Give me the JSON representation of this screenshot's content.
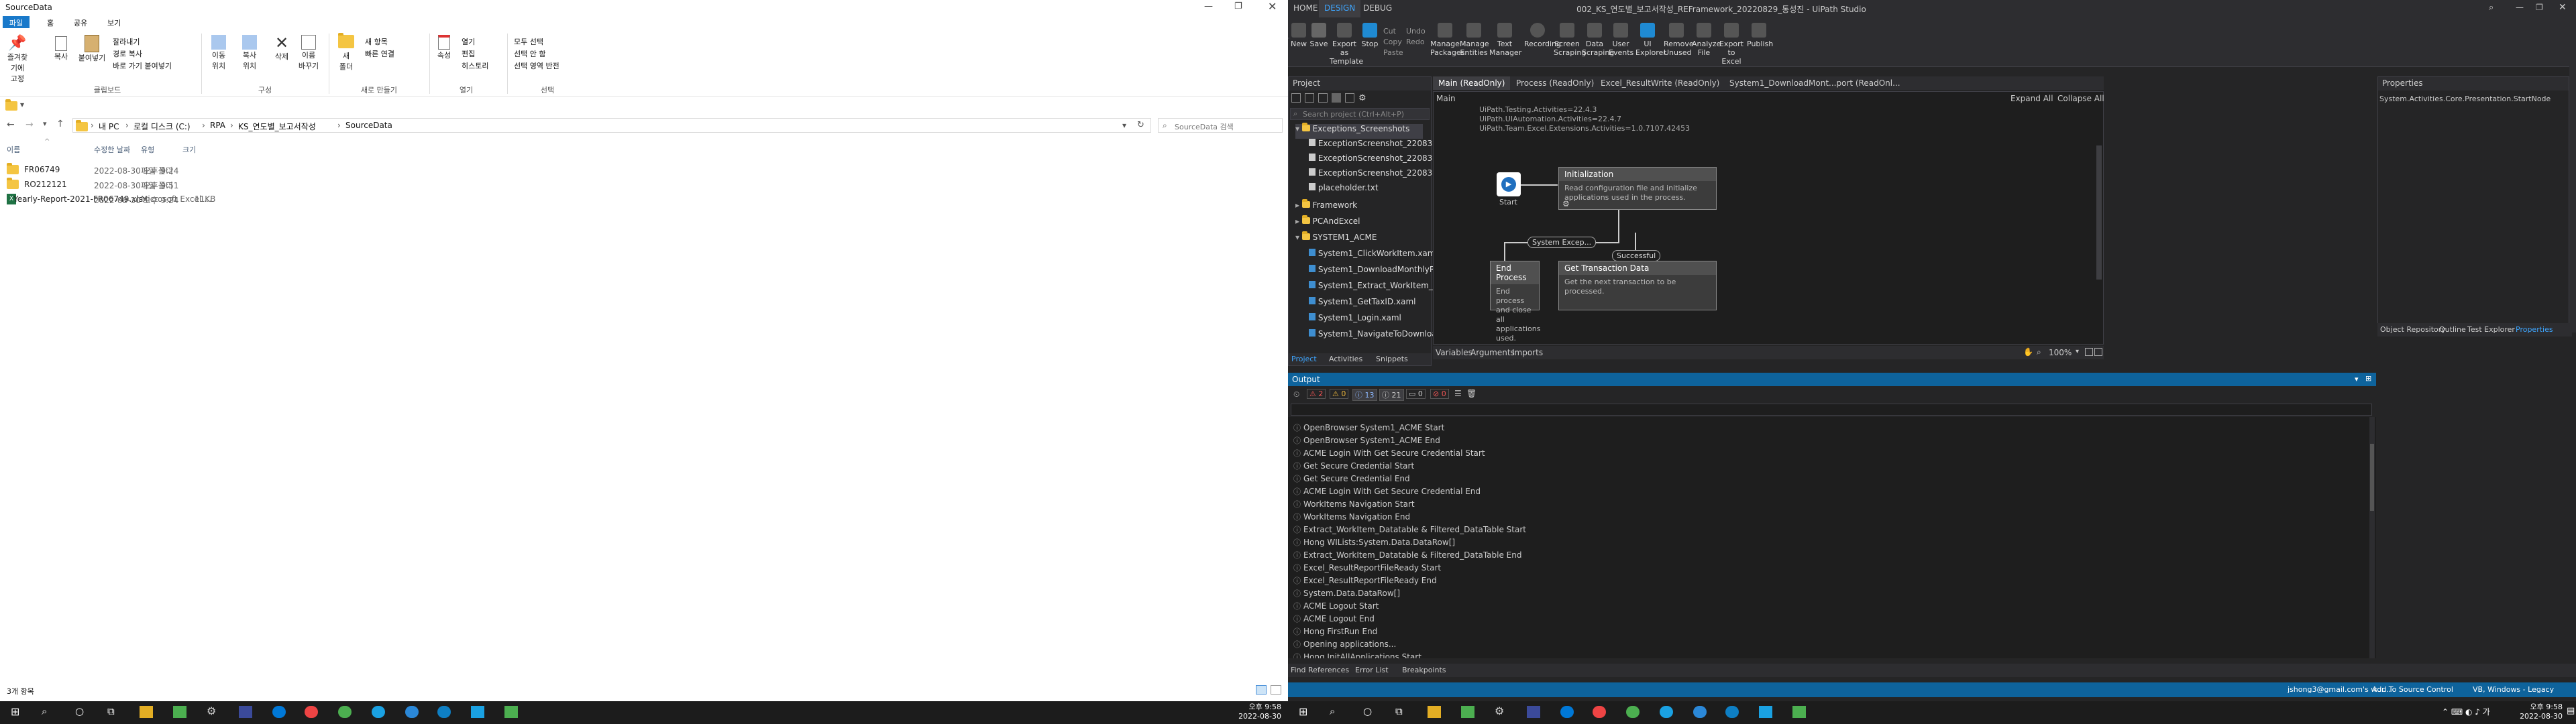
{
  "explorer": {
    "title": "SourceData",
    "tabs": [
      "파일",
      "홈",
      "공유",
      "보기"
    ],
    "ribbon": {
      "buttons": [
        "즐겨찾기에\n고정",
        "복사",
        "붙여넣기",
        "이동\n위치",
        "복사\n위치",
        "삭제",
        "이름\n바꾸기",
        "새\n폴더",
        "속성",
        "모두 선택",
        "선택 안 함",
        "선택 영역 반전",
        "열기",
        "편집",
        "히스토리"
      ],
      "small": [
        "잘라내기",
        "경로 복사",
        "바로 가기 붙여넣기",
        "새 항목",
        "빠른 연결"
      ],
      "groups": [
        "클립보드",
        "구성",
        "새로 만들기",
        "열기",
        "선택"
      ]
    },
    "breadcrumb": [
      "내 PC",
      "로컬 디스크 (C:)",
      "RPA",
      "KS_연도별_보고서작성",
      "SourceData"
    ],
    "search_placeholder": "SourceData 검색",
    "columns": [
      "이름",
      "수정한 날짜",
      "유형",
      "크기"
    ],
    "files": [
      {
        "name": "FR06749",
        "date": "2022-08-30 오후 9:24",
        "type": "파일 폴더",
        "size": ""
      },
      {
        "name": "RO212121",
        "date": "2022-08-30 오후 9:51",
        "type": "파일 폴더",
        "size": ""
      },
      {
        "name": "Yearly-Report-2021-FR06749.xlsx",
        "date": "2022-08-30 오후 9:24",
        "type": "Microsoft Excel ...",
        "size": "11KB"
      }
    ],
    "status": "3개 항목"
  },
  "studio": {
    "title": "002_KS_연도별_보고서작성_REFramework_20220829_통성진 - UiPath Studio",
    "menu": [
      "HOME",
      "DESIGN",
      "DEBUG"
    ],
    "toolbar": [
      "New",
      "Save",
      "Export as Template",
      "Stop",
      "Manage Packages",
      "Manage Entities",
      "Text Manager",
      "Recording",
      "Screen Scraping",
      "Data Scraping",
      "User Events",
      "UI Explorer",
      "Remove Unused",
      "Analyze File",
      "Export to Excel",
      "Publish"
    ],
    "small": [
      "Cut",
      "Copy",
      "Paste",
      "Undo",
      "Redo"
    ],
    "project": {
      "title": "Project",
      "search_placeholder": "Search project (Ctrl+Alt+P)",
      "items": [
        "Exceptions_Screenshots",
        "ExceptionScreenshot_220830.092507.png",
        "ExceptionScreenshot_220830.093045.png",
        "ExceptionScreenshot_220830.095226.png",
        "placeholder.txt",
        "Framework",
        "PCAndExcel",
        "SYSTEM1_ACME",
        "System1_ClickWorkItem.xaml",
        "System1_DownloadMonthlyReport.xaml",
        "System1_Extract_WorkItem_DataTable.xaml",
        "System1_GetTaxID.xaml",
        "System1_Login.xaml",
        "System1_NavigateToDownload.xaml"
      ],
      "tabs": [
        "Project",
        "Activities",
        "Snippets"
      ]
    },
    "doc_tabs": [
      "Main (ReadOnly)",
      "Process (ReadOnly)",
      "Excel_ResultWrite (ReadOnly)",
      "System1_DownloadMont...port (ReadOnl..."
    ],
    "designer": {
      "breadcrumb": "Main",
      "expand": "Expand All",
      "collapse": "Collapse All",
      "imports": [
        "UiPath.Testing.Activities=22.4.3",
        "UiPath.UIAutomation.Activities=22.4.7",
        "UiPath.Team.Excel.Extensions.Activities=1.0.7107.42453"
      ],
      "start": "Start",
      "init_title": "Initialization",
      "init_desc": "Read configuration file and initialize applications used in the process.",
      "system_label": "System Excep...",
      "success_label": "Successful",
      "end_title": "End Process",
      "end_desc": "End process and close all applications used.",
      "get_title": "Get Transaction Data",
      "get_desc": "Get the next transaction to be processed.",
      "bottom_tabs": [
        "Variables",
        "Arguments",
        "Imports"
      ],
      "zoom": "100%"
    },
    "properties": {
      "title": "Properties",
      "value": "System.Activities.Core.Presentation.StartNode",
      "tabs": [
        "Object Repository",
        "Outline",
        "Test Explorer",
        "Properties"
      ]
    },
    "output": {
      "title": "Output",
      "counts": [
        "2",
        "0",
        "13",
        "21",
        "0",
        "0"
      ],
      "lines": [
        "OpenBrowser System1_ACME Start",
        "OpenBrowser System1_ACME End",
        "ACME Login With Get Secure Credential Start",
        "Get Secure Credential Start",
        "Get Secure Credential End",
        "ACME Login With Get Secure Credential End",
        "WorkItems Navigation Start",
        "WorkItems Navigation End",
        "Extract_WorkItem_Datatable & Filtered_DataTable Start",
        "Hong WILists:System.Data.DataRow[]",
        "Extract_WorkItem_Datatable & Filtered_DataTable End",
        "Excel_ResultReportFileReady Start",
        "Excel_ResultReportFileReady End",
        "System.Data.DataRow[]",
        "ACME Logout Start",
        "ACME Logout End",
        "Hong FirstRun End",
        "Opening applications...",
        "Hong InitAllApplications Start"
      ]
    },
    "bottom_tabs": [
      "Find References",
      "Error List",
      "Breakpoints"
    ],
    "status": {
      "user": "jshong3@gmail.com's wor...",
      "source": "Add To Source Control",
      "env": "VB, Windows - Legacy"
    }
  },
  "taskbar": {
    "time": "오후 9:58",
    "date": "2022-08-30"
  }
}
